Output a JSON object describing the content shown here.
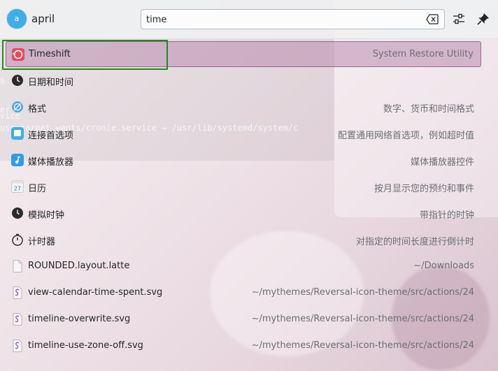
{
  "background": {
    "terminal_lines": [
      "s",
      "er",
      "vice",
      "use.target.wants/cronie.service → /usr/lib/systemd/system/c"
    ]
  },
  "header": {
    "avatar_initial": "a",
    "username": "april",
    "search_value": "time",
    "icons": [
      "clear-icon",
      "settings-sliders-icon",
      "pin-icon"
    ]
  },
  "results": [
    {
      "title": "Timeshift",
      "subtitle": "System Restore Utility",
      "icon": "timeshift-icon",
      "selected": true
    },
    {
      "title": "日期和时间",
      "subtitle": "",
      "icon": "clock-icon"
    },
    {
      "title": "格式",
      "subtitle": "数字、货币和时间格式",
      "icon": "locale-format-icon"
    },
    {
      "title": "连接首选项",
      "subtitle": "配置通用网络首选项，例如超时值",
      "icon": "network-preferences-icon"
    },
    {
      "title": "媒体播放器",
      "subtitle": "媒体播放器控件",
      "icon": "media-player-icon"
    },
    {
      "title": "日历",
      "subtitle": "按月显示您的预约和事件",
      "icon": "calendar-icon"
    },
    {
      "title": "模拟时钟",
      "subtitle": "带指针的时钟",
      "icon": "analog-clock-icon"
    },
    {
      "title": "计时器",
      "subtitle": "对指定的时间长度进行倒计时",
      "icon": "timer-icon"
    },
    {
      "title": "ROUNDED.layout.latte",
      "subtitle": "~/Downloads",
      "icon": "file-icon"
    },
    {
      "title": "view-calendar-time-spent.svg",
      "subtitle": "~/mythemes/Reversal-icon-theme/src/actions/24",
      "icon": "svg-file-icon"
    },
    {
      "title": "timeline-overwrite.svg",
      "subtitle": "~/mythemes/Reversal-icon-theme/src/actions/24",
      "icon": "svg-file-icon"
    },
    {
      "title": "timeline-use-zone-off.svg",
      "subtitle": "~/mythemes/Reversal-icon-theme/src/actions/24",
      "icon": "svg-file-icon"
    }
  ],
  "colors": {
    "accent": "#3daee9",
    "selected_bg": "#c79ab9",
    "annotation_box": "#1e8a1e"
  }
}
